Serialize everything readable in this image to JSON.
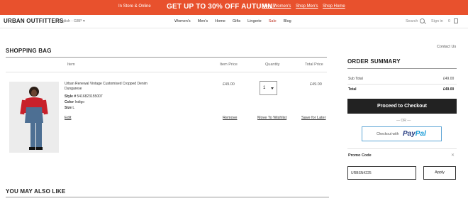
{
  "promo_bar": {
    "store_text": "In Store & Online",
    "headline": "GET UP TO 30% OFF AUTUMN!",
    "links": [
      "Shop Women's",
      "Shop Men's",
      "Shop Home"
    ]
  },
  "header": {
    "logo": "URBAN OUTFITTERS",
    "region": "English - GBP",
    "nav": [
      "Women's",
      "Men's",
      "Home",
      "Gifts",
      "Lingerie",
      "Sale",
      "Blog"
    ],
    "search_label": "Search",
    "sign_in": "Sign in",
    "bag_count": "0"
  },
  "contact": "Contact Us",
  "bag": {
    "title": "SHOPPING BAG",
    "columns": {
      "item": "Item",
      "item_price": "Item Price",
      "quantity": "Quantity",
      "total_price": "Total Price"
    },
    "product": {
      "name": "Urban Renewal Vintage Customised Cropped Denim Dungarese",
      "style_label": "Style #",
      "style_value": "5416823155007",
      "color_label": "Color",
      "color_value": "Indigo",
      "size_label": "Size",
      "size_value": "L",
      "price": "£49.00",
      "quantity": "1",
      "total": "£49.00",
      "edit": "Edit",
      "remove": "Remove",
      "move": "Move To Wishlist",
      "save": "Save for Later"
    }
  },
  "summary": {
    "title": "ORDER SUMMARY",
    "subtotal_label": "Sub Total",
    "subtotal_value": "£49.00",
    "total_label": "Total",
    "total_value": "£49.00",
    "checkout": "Proceed to Checkout",
    "or": "— OR —",
    "paypal_prefix": "Checkout with",
    "paypal_logo_a": "Pay",
    "paypal_logo_b": "Pal",
    "promo_label": "Promo Code",
    "promo_value": "URBSN4225",
    "apply": "Apply"
  },
  "also_like": {
    "title": "YOU MAY ALSO LIKE"
  }
}
